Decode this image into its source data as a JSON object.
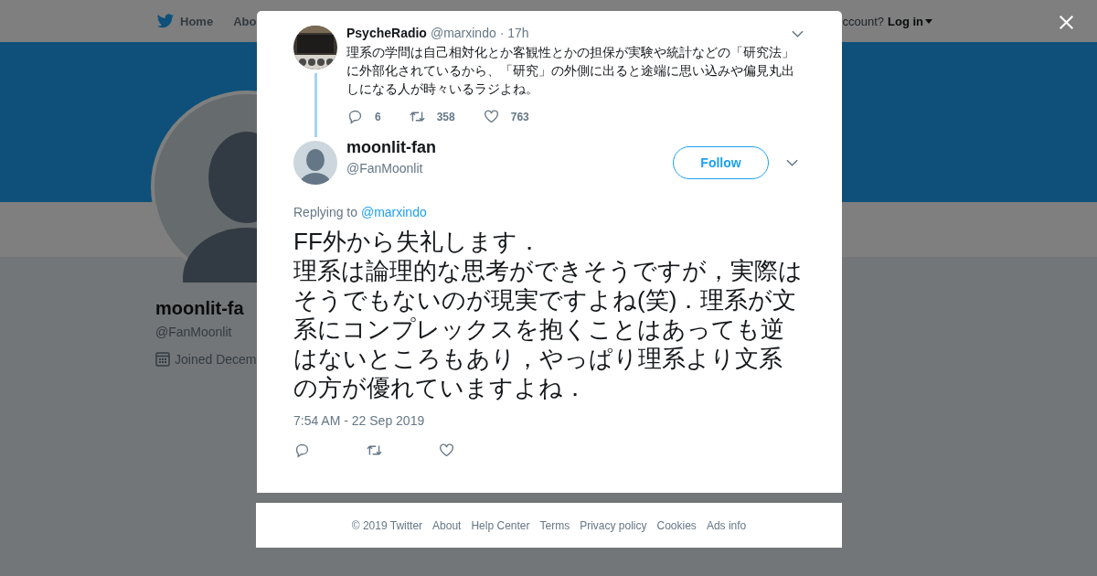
{
  "nav": {
    "items": [
      "Home",
      "Abo"
    ],
    "account_prompt": "ccount?",
    "login": "Log in"
  },
  "profile": {
    "name": "moonlit-fa",
    "handle": "@FanMoonlit",
    "joined": "Joined Decem"
  },
  "modal": {
    "parent_tweet": {
      "name": "PsycheRadio",
      "handle": "@marxindo",
      "time": "· 17h",
      "text": "理系の学問は自己相対化とか客観性とかの担保が実験や統計などの「研究法」に外部化されているから、「研究」の外側に出ると途端に思い込みや偏見丸出しになる人が時々いるラジよね。",
      "replies": "6",
      "retweets": "358",
      "likes": "763"
    },
    "tweet": {
      "name": "moonlit-fan",
      "handle": "@FanMoonlit",
      "follow": "Follow",
      "replying_label": "Replying to",
      "replying_to": "@marxindo",
      "text": [
        "FF外から失礼します．",
        "理系は論理的な思考ができそうですが，実際はそうでもないのが現実ですよね(笑)．理系が文系にコンプレックスを抱くことはあっても逆はないところもあり，やっぱり理系より文系の方が優れていますよね．"
      ],
      "timestamp": "7:54 AM - 22 Sep 2019"
    }
  },
  "footer": {
    "links": [
      "© 2019 Twitter",
      "About",
      "Help Center",
      "Terms",
      "Privacy policy",
      "Cookies",
      "Ads info"
    ]
  }
}
